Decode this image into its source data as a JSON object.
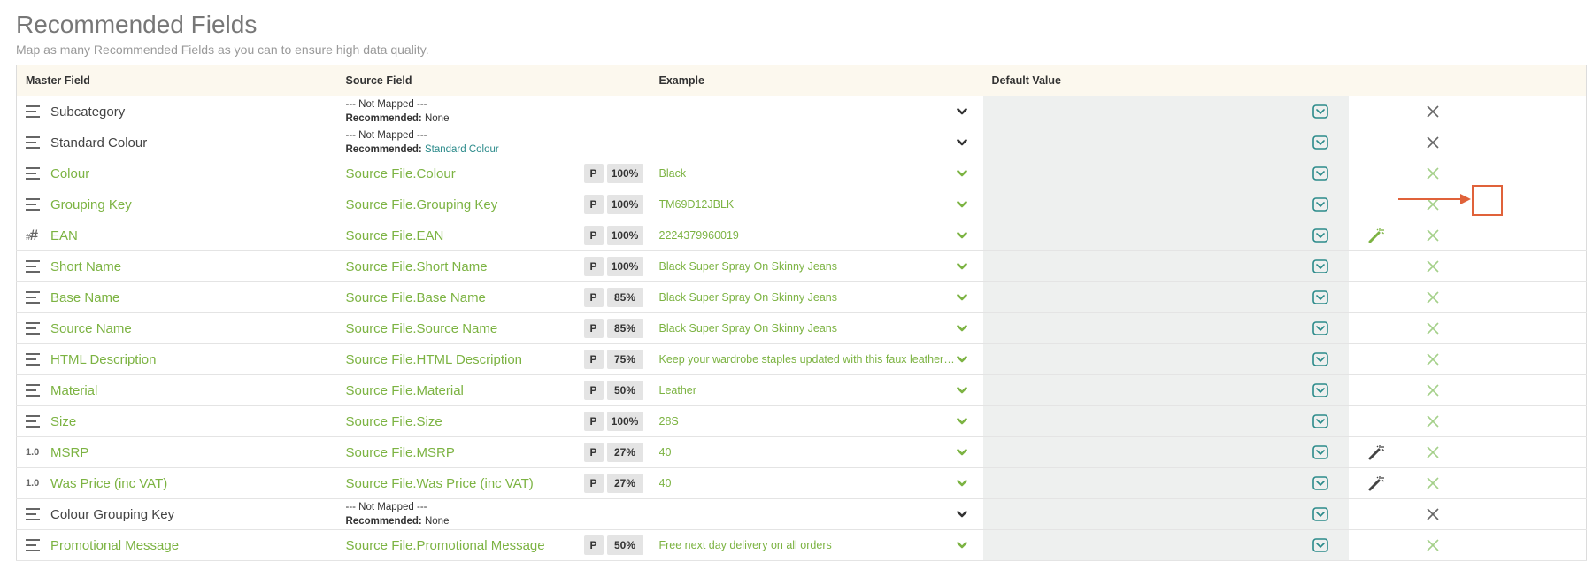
{
  "header": {
    "title": "Recommended Fields",
    "subtitle": "Map as many Recommended Fields as you can to ensure high data quality."
  },
  "columns": {
    "master": "Master Field",
    "source": "Source Field",
    "example": "Example",
    "default": "Default Value"
  },
  "labels": {
    "not_mapped": "--- Not Mapped ---",
    "recommended": "Recommended:",
    "p": "P",
    "num_icon": "1.0",
    "hash_small": "#",
    "hash_big": "#"
  },
  "rows": [
    {
      "name": "Subcategory",
      "type": "text",
      "mapped": false,
      "recommended": "None",
      "recommended_link": false
    },
    {
      "name": "Standard Colour",
      "type": "text",
      "mapped": false,
      "recommended": "Standard Colour",
      "recommended_link": true
    },
    {
      "name": "Colour",
      "type": "text",
      "mapped": true,
      "source": "Source File.Colour",
      "pct": "100%",
      "example": "Black"
    },
    {
      "name": "Grouping Key",
      "type": "text",
      "mapped": true,
      "source": "Source File.Grouping Key",
      "pct": "100%",
      "example": "TM69D12JBLK"
    },
    {
      "name": "EAN",
      "type": "hash",
      "mapped": true,
      "source": "Source File.EAN",
      "pct": "100%",
      "example": "2224379960019",
      "magic": "green"
    },
    {
      "name": "Short Name",
      "type": "text",
      "mapped": true,
      "source": "Source File.Short Name",
      "pct": "100%",
      "example": "Black Super Spray On Skinny Jeans"
    },
    {
      "name": "Base Name",
      "type": "text",
      "mapped": true,
      "source": "Source File.Base Name",
      "pct": "85%",
      "example": "Black Super Spray On Skinny Jeans"
    },
    {
      "name": "Source Name",
      "type": "text",
      "mapped": true,
      "source": "Source File.Source Name",
      "pct": "85%",
      "example": "Black Super Spray On Skinny Jeans"
    },
    {
      "name": "HTML Description",
      "type": "text",
      "mapped": true,
      "source": "Source File.HTML Description",
      "pct": "75%",
      "example": "Keep your wardrobe staples updated with this faux leather mini skirt"
    },
    {
      "name": "Material",
      "type": "text",
      "mapped": true,
      "source": "Source File.Material",
      "pct": "50%",
      "example": "Leather"
    },
    {
      "name": "Size",
      "type": "text",
      "mapped": true,
      "source": "Source File.Size",
      "pct": "100%",
      "example": "28S"
    },
    {
      "name": "MSRP",
      "type": "num",
      "mapped": true,
      "source": "Source File.MSRP",
      "pct": "27%",
      "example": "40",
      "magic": "dark"
    },
    {
      "name": "Was Price (inc VAT)",
      "type": "num",
      "mapped": true,
      "source": "Source File.Was Price (inc VAT)",
      "pct": "27%",
      "example": "40",
      "magic": "dark"
    },
    {
      "name": "Colour Grouping Key",
      "type": "text",
      "mapped": false,
      "recommended": "None",
      "recommended_link": false
    },
    {
      "name": "Promotional Message",
      "type": "text",
      "mapped": true,
      "source": "Source File.Promotional Message",
      "pct": "50%",
      "example": "Free next day delivery on all orders"
    }
  ],
  "colors": {
    "mapped": "#7cb342",
    "teal": "#2a8a8a",
    "highlight": "#e0623a",
    "header_bg": "#fcf8ee"
  },
  "icons": {
    "text_type": "lines-icon",
    "hash_type": "hash-icon",
    "num_type": "number-icon",
    "dropdown": "chevron-down-icon",
    "default_toggle": "chevron-square-icon",
    "magic": "magic-wand-icon",
    "remove": "close-icon"
  }
}
